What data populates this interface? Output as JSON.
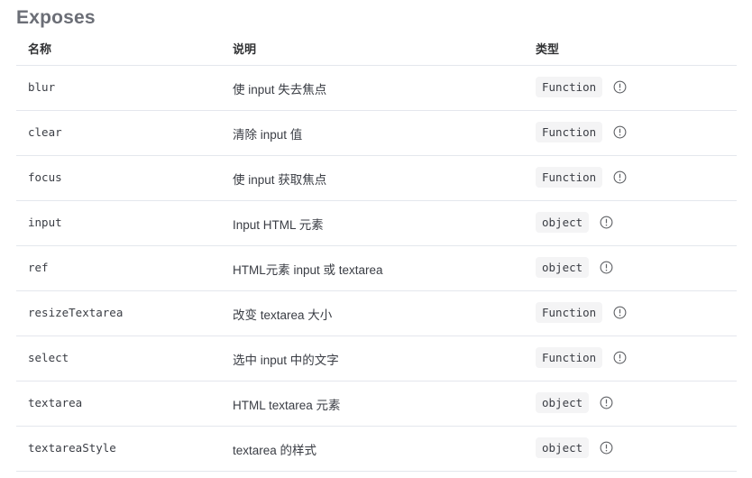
{
  "title": "Exposes",
  "columns": [
    "名称",
    "说明",
    "类型"
  ],
  "rows": [
    {
      "name": "blur",
      "description": "使 input 失去焦点",
      "type": "Function"
    },
    {
      "name": "clear",
      "description": "清除 input 值",
      "type": "Function"
    },
    {
      "name": "focus",
      "description": "使 input 获取焦点",
      "type": "Function"
    },
    {
      "name": "input",
      "description": "Input HTML 元素",
      "type": "object"
    },
    {
      "name": "ref",
      "description": "HTML元素 input 或 textarea",
      "type": "object"
    },
    {
      "name": "resizeTextarea",
      "description": "改变 textarea 大小",
      "type": "Function"
    },
    {
      "name": "select",
      "description": "选中 input 中的文字",
      "type": "Function"
    },
    {
      "name": "textarea",
      "description": "HTML textarea 元素",
      "type": "object"
    },
    {
      "name": "textareaStyle",
      "description": "textarea 的样式",
      "type": "object"
    }
  ],
  "icons": {
    "type_info": "info-circle-icon"
  },
  "colors": {
    "border": "#e4e7ed",
    "badge_bg": "#f4f4f5",
    "title": "#6b6e76"
  }
}
